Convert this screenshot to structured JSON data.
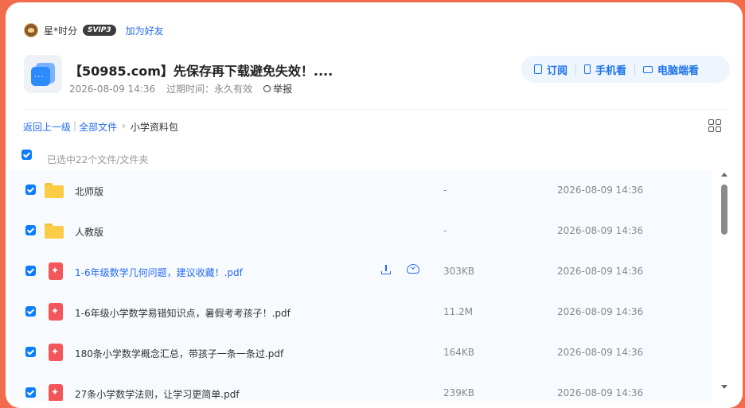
{
  "owner": {
    "name": "星*时分",
    "badge": "SVIP3",
    "add_friend": "加为好友"
  },
  "share": {
    "title": "【50985.com】先保存再下载避免失效！....",
    "created": "2026-08-09 14:36",
    "expire": "过期时间：永久有效",
    "report": "举报"
  },
  "actions": {
    "subscribe": "订阅",
    "phone": "手机看",
    "pc": "电脑端看"
  },
  "breadcrumb": {
    "back": "返回上一级",
    "all_files": "全部文件",
    "current": "小学资料包"
  },
  "selection": {
    "text": "已选中22个文件/文件夹"
  },
  "files": [
    {
      "type": "folder",
      "name": "北师版",
      "size": "-",
      "date": "2026-08-09 14:36"
    },
    {
      "type": "folder",
      "name": "人教版",
      "size": "-",
      "date": "2026-08-09 14:36"
    },
    {
      "type": "pdf",
      "name": "1-6年级数学几何问题，建议收藏！.pdf",
      "size": "303KB",
      "date": "2026-08-09 14:36"
    },
    {
      "type": "pdf",
      "name": "1-6年级小学数学易错知识点，暑假考考孩子！.pdf",
      "size": "11.2M",
      "date": "2026-08-09 14:36"
    },
    {
      "type": "pdf",
      "name": "180条小学数学概念汇总，带孩子一条一条过.pdf",
      "size": "164KB",
      "date": "2026-08-09 14:36"
    },
    {
      "type": "pdf",
      "name": "27条小学数学法则，让学习更简单.pdf",
      "size": "239KB",
      "date": "2026-08-09 14:36"
    }
  ],
  "colors": {
    "accent": "#2468f2",
    "checkbox": "#0a7cff",
    "background": "#f26b4c"
  }
}
